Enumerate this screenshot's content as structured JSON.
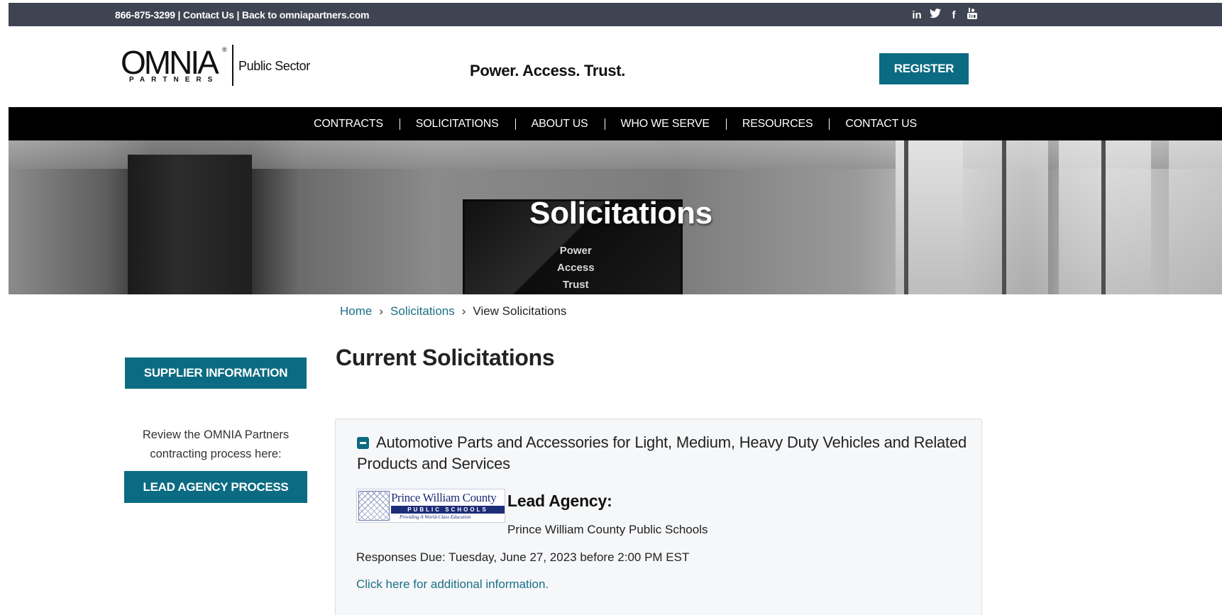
{
  "utility_bar": {
    "phone": "866-875-3299",
    "sep1": " | ",
    "contact": "Contact Us",
    "sep2": " | ",
    "back": "Back to omniapartners.com",
    "social": [
      {
        "icon": "linkedin-icon",
        "glyph": "in"
      },
      {
        "icon": "twitter-icon",
        "glyph": "✦"
      },
      {
        "icon": "facebook-icon",
        "glyph": "f"
      },
      {
        "icon": "youtube-icon",
        "glyph": "▶"
      }
    ]
  },
  "header": {
    "logo_word": "OMNIA",
    "logo_reg": "®",
    "logo_partners": "PARTNERS",
    "logo_sector": "Public Sector",
    "tagline": "Power. Access. Trust.",
    "register_label": "REGISTER"
  },
  "nav": {
    "items": [
      "CONTRACTS",
      "SOLICITATIONS",
      "ABOUT US",
      "WHO WE SERVE",
      "RESOURCES",
      "CONTACT US"
    ]
  },
  "hero": {
    "title": "Solicitations",
    "screen_lines": [
      "Power",
      "Access",
      "Trust"
    ]
  },
  "breadcrumb": {
    "home": "Home",
    "solicitations": "Solicitations",
    "current": "View Solicitations",
    "separator": "›"
  },
  "sidebar": {
    "supplier_label": "SUPPLIER INFORMATION",
    "note": "Review the OMNIA Partners contracting process here:",
    "lead_label": "LEAD AGENCY PROCESS"
  },
  "main": {
    "title": "Current Solicitations",
    "solicitation": {
      "title": "Automotive Parts and Accessories for Light, Medium, Heavy Duty Vehicles and Related Products and Services",
      "agency_logo": {
        "name": "Prince William County",
        "bar": "PUBLIC SCHOOLS",
        "tag": "Providing A World-Class Education"
      },
      "lead_label": "Lead Agency:",
      "agency_name": "Prince William County Public Schools",
      "due": "Responses Due: Tuesday, June 27, 2023 before 2:00 PM EST",
      "more_link": "Click here for additional information."
    }
  },
  "colors": {
    "accent": "#0b6b82",
    "utility_bg": "#3f4452",
    "nav_bg": "#000000",
    "link": "#1a6f86"
  }
}
